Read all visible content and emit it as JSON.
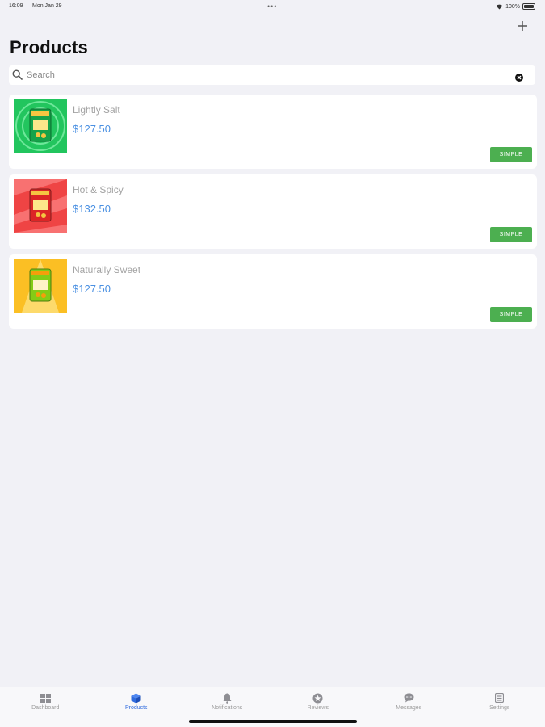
{
  "status_bar": {
    "time": "16:09",
    "date": "Mon Jan 29",
    "dots": "•••",
    "battery": "100%"
  },
  "header": {
    "title": "Products",
    "add_icon": "plus-icon"
  },
  "search": {
    "placeholder": "Search",
    "value": "",
    "icon": "search-icon",
    "clear_icon": "clear-icon"
  },
  "products": [
    {
      "name": "Lightly Salt",
      "price": "$127.50",
      "type": "SIMPLE",
      "thumb_bg": "#22c55e"
    },
    {
      "name": "Hot & Spicy",
      "price": "$132.50",
      "type": "SIMPLE",
      "thumb_bg": "#ef4444"
    },
    {
      "name": "Naturally Sweet",
      "price": "$127.50",
      "type": "SIMPLE",
      "thumb_bg": "#fbbf24"
    }
  ],
  "tabs": [
    {
      "label": "Dashboard",
      "icon": "grid-icon",
      "active": false
    },
    {
      "label": "Products",
      "icon": "cube-icon",
      "active": true
    },
    {
      "label": "Notifications",
      "icon": "bell-icon",
      "active": false
    },
    {
      "label": "Reviews",
      "icon": "star-icon",
      "active": false
    },
    {
      "label": "Messages",
      "icon": "chat-bubble-icon",
      "active": false
    },
    {
      "label": "Settings",
      "icon": "settings-list-icon",
      "active": false
    }
  ],
  "colors": {
    "accent": "#2f6bde",
    "price": "#4a90e2",
    "badge": "#4caf50",
    "background": "#f1f1f6"
  }
}
